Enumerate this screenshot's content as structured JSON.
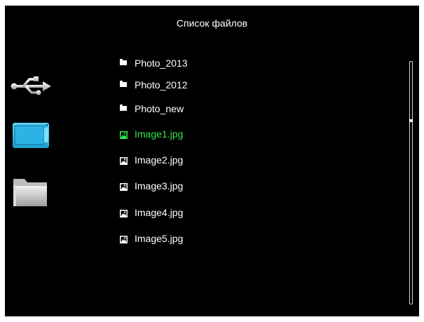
{
  "header": {
    "title": "Список файлов"
  },
  "sources": [
    {
      "icon": "usb-icon"
    },
    {
      "icon": "sd-card-icon"
    },
    {
      "icon": "folder-icon"
    }
  ],
  "files": [
    {
      "name": "Photo_2013",
      "type": "folder",
      "selected": false
    },
    {
      "name": "Photo_2012",
      "type": "folder",
      "selected": false
    },
    {
      "name": "Photo_new",
      "type": "folder",
      "selected": false
    },
    {
      "name": "Image1.jpg",
      "type": "image",
      "selected": true
    },
    {
      "name": "Image2.jpg",
      "type": "image",
      "selected": false
    },
    {
      "name": "Image3.jpg",
      "type": "image",
      "selected": false
    },
    {
      "name": "Image4.jpg",
      "type": "image",
      "selected": false
    },
    {
      "name": "Image5.jpg",
      "type": "image",
      "selected": false
    }
  ],
  "colors": {
    "background": "#000000",
    "text": "#ffffff",
    "selected": "#38e94a",
    "card": "#29b6e8"
  }
}
